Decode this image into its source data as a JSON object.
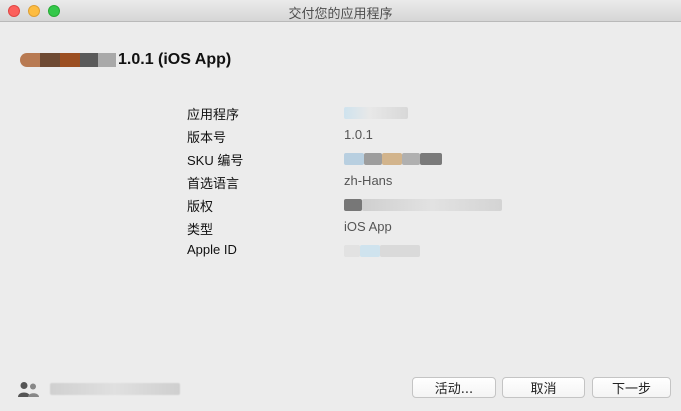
{
  "window": {
    "title": "交付您的应用程序"
  },
  "app_header": {
    "title": "1.0.1 (iOS App)"
  },
  "info": {
    "rows": [
      {
        "label": "应用程序",
        "value": ""
      },
      {
        "label": "版本号",
        "value": "1.0.1"
      },
      {
        "label": "SKU 编号",
        "value": ""
      },
      {
        "label": "首选语言",
        "value": "zh-Hans"
      },
      {
        "label": "版权",
        "value": ""
      },
      {
        "label": "类型",
        "value": "iOS App"
      },
      {
        "label": "Apple ID",
        "value": ""
      }
    ]
  },
  "footer": {
    "user_icon": "user-accounts-icon",
    "email": "",
    "buttons": {
      "activity": "活动...",
      "cancel": "取消",
      "next": "下一步"
    }
  },
  "colors": {
    "close": "#fc605c",
    "minimize": "#fdbc40",
    "maximize": "#34c84a"
  }
}
